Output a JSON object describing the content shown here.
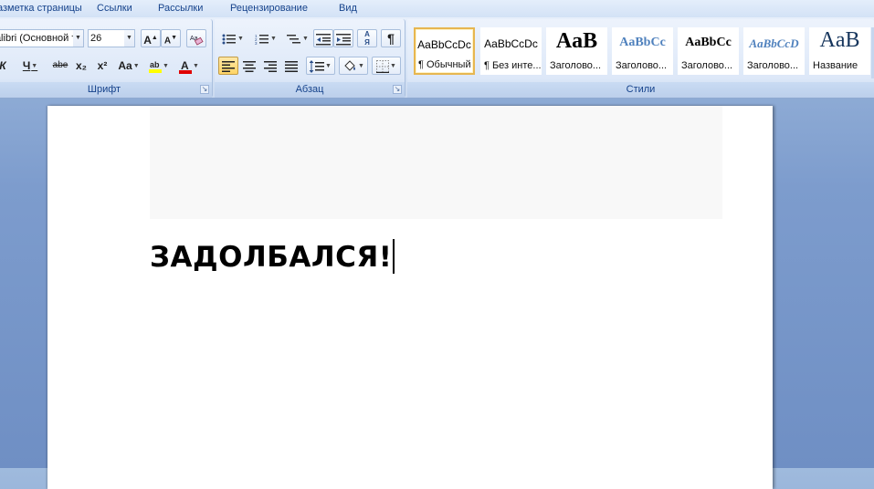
{
  "tabs": [
    "Разметка страницы",
    "Ссылки",
    "Рассылки",
    "Рецензирование",
    "Вид"
  ],
  "font_group": {
    "label": "Шрифт",
    "font_name": "Calibri (Основной текст)",
    "font_size": "26",
    "grow_label": "A",
    "shrink_label": "A",
    "italic": "К",
    "underline": "Ч",
    "strike": "abe",
    "subscript": "x₂",
    "superscript": "x²",
    "change_case": "Aa",
    "highlight_icon": "highlighter-icon",
    "font_color": "A",
    "highlight_color": "#ffff00",
    "font_color_value": "#e00000"
  },
  "paragraph_group": {
    "label": "Абзац",
    "sort_label": "А Я",
    "pilcrow": "¶"
  },
  "styles_group": {
    "label": "Стили",
    "items": [
      {
        "sample": "AaBbCcDc",
        "name": "¶ Обычный",
        "selected": true
      },
      {
        "sample": "AaBbCcDc",
        "name": "¶ Без инте..."
      },
      {
        "sample": "AaB",
        "name": "Заголово..."
      },
      {
        "sample": "AaBbCc",
        "name": "Заголово..."
      },
      {
        "sample": "AaBbCc",
        "name": "Заголово..."
      },
      {
        "sample": "AaBbCcD",
        "name": "Заголово..."
      },
      {
        "sample": "AaB",
        "name": "Название"
      }
    ]
  },
  "document": {
    "text": "ЗАДОЛБАЛСЯ!"
  }
}
